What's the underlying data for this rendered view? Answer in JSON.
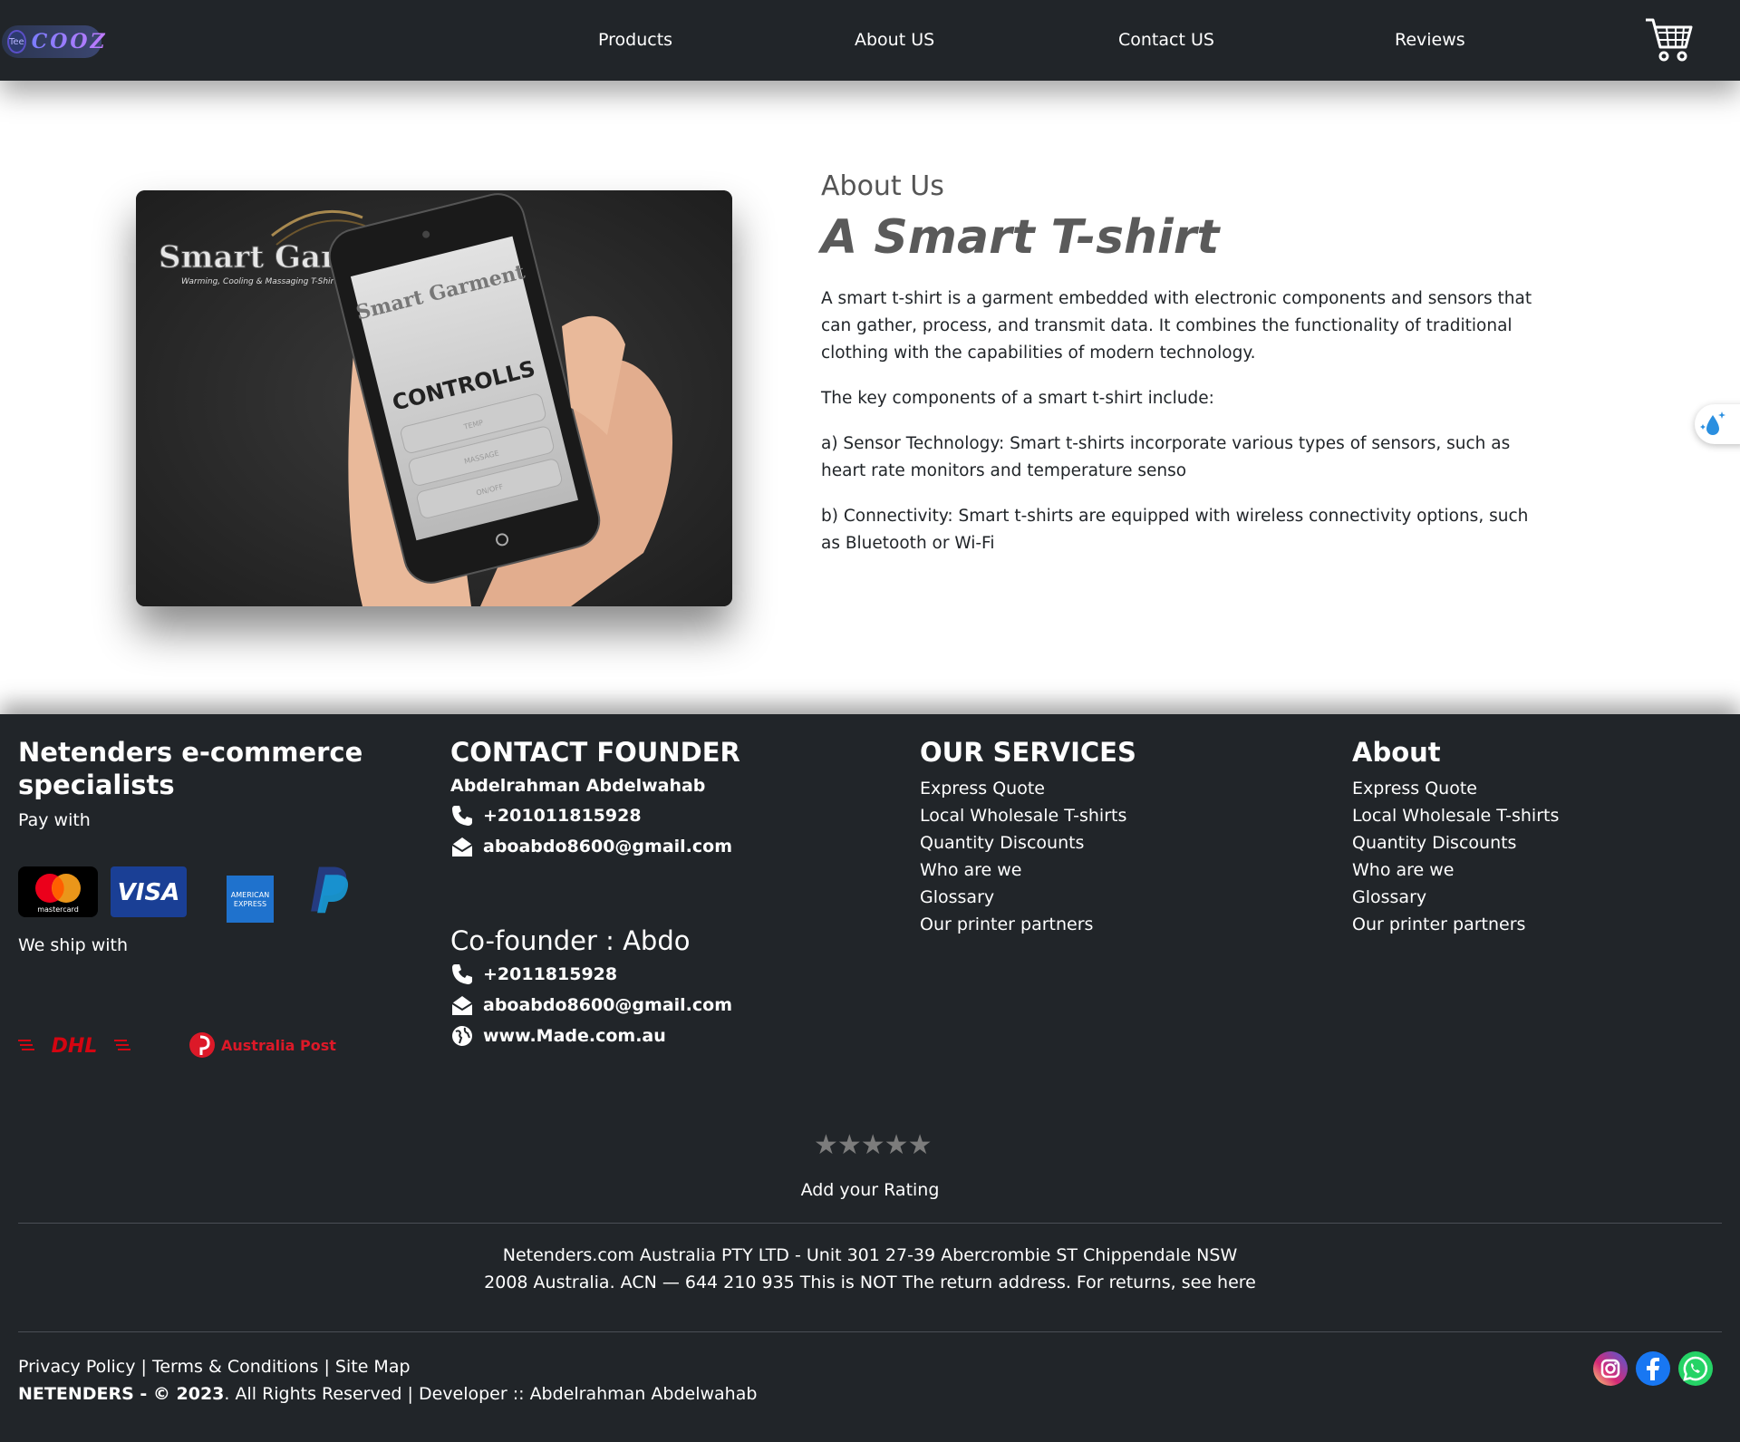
{
  "nav": {
    "logo_text": "COOZ",
    "logo_badge": "Tee",
    "links": [
      "Products",
      "About US",
      "Contact US",
      "Reviews"
    ]
  },
  "about": {
    "image_brand": "Smart Garment",
    "image_tagline": "Warming, Cooling & Massaging T-Shirt",
    "image_phone_label": "CONTROLLS",
    "image_phone_buttons": [
      "TEMP",
      "MASSAGE",
      "ON/OFF"
    ],
    "kicker": "About Us",
    "title": "A Smart T-shirt",
    "paragraphs": [
      "A smart t-shirt is a garment embedded with electronic components and sensors that can gather, process, and transmit data. It combines the functionality of traditional clothing with the capabilities of modern technology.",
      "The key components of a smart t-shirt include:",
      "a) Sensor Technology: Smart t-shirts incorporate various types of sensors, such as heart rate monitors and temperature senso",
      "b) Connectivity: Smart t-shirts are equipped with wireless connectivity options, such as Bluetooth or Wi-Fi"
    ]
  },
  "footer": {
    "brand_heading": "Netenders e-commerce specialists",
    "pay_with": "Pay with",
    "payment_logos": [
      "mastercard",
      "VISA",
      "AMERICAN EXPRESS",
      "PayPal"
    ],
    "ship_with": "We ship with",
    "shipping_logos": [
      "DHL",
      "Australia Post"
    ],
    "contact_heading": "CONTACT FOUNDER",
    "founder_name": "Abdelrahman Abdelwahab",
    "founder_phone": "+201011815928",
    "founder_email": "aboabdo8600@gmail.com",
    "cofounder_heading": "Co-founder : Abdo",
    "cofounder_phone": "+2011815928",
    "cofounder_email": "aboabdo8600@gmail.com",
    "cofounder_web": "www.Made.com.au",
    "services_heading": "OUR SERVICES",
    "services": [
      "Express Quote",
      "Local Wholesale T-shirts",
      "Quantity Discounts",
      "Who are we",
      "Glossary",
      "Our printer partners"
    ],
    "about_heading": "About",
    "about_links": [
      "Express Quote",
      "Local Wholesale T-shirts",
      "Quantity Discounts",
      "Who are we",
      "Glossary",
      "Our printer partners"
    ],
    "stars": "★★★★★",
    "rating_label": "Add your Rating",
    "address_line1": "Netenders.com Australia PTY LTD - Unit 301 27-39 Abercrombie ST Chippendale NSW",
    "address_line2": "2008 Australia. ACN — 644 210 935 This is NOT The return address. For returns, see here",
    "legal_links": [
      "Privacy Policy",
      "Terms & Conditions",
      "Site Map"
    ],
    "legal_sep": "|",
    "copyright_brand": "NETENDERS - © 2023",
    "copyright_rest": ". All Rights Reserved | Developer :: Abdelrahman Abdelwahab",
    "social": [
      "instagram-icon",
      "facebook-icon",
      "whatsapp-icon"
    ]
  },
  "colors": {
    "navbar_bg": "#212529",
    "footer_bg": "#212529",
    "title_gray": "#5a5a5a",
    "dhl_red": "#d40511",
    "auspost_red": "#dc1928",
    "visa_blue": "#1a3f95",
    "amex_blue": "#1f72cd",
    "paypal_blue": "#253b80"
  }
}
